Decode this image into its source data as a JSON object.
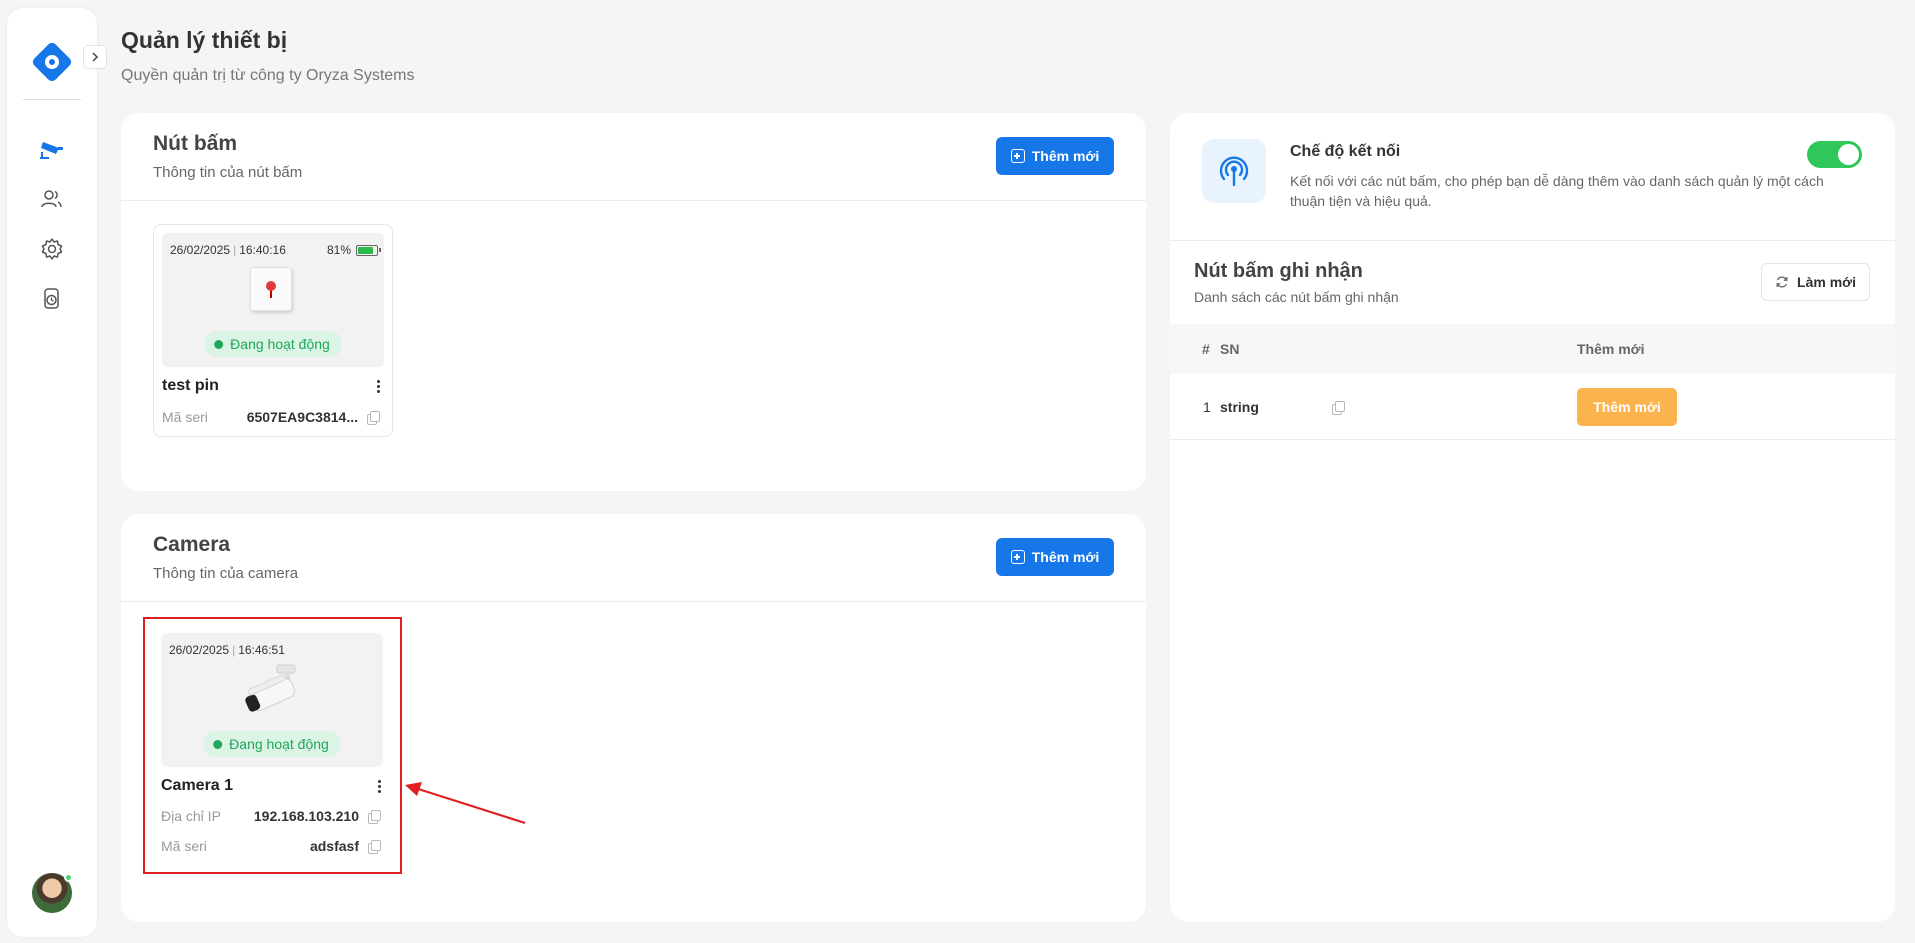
{
  "page": {
    "title": "Quản lý thiết bị",
    "subtitle": "Quyền quản trị từ công ty Oryza Systems"
  },
  "sidebar": {
    "items": [
      {
        "icon": "camera-icon"
      },
      {
        "icon": "users-icon"
      },
      {
        "icon": "settings-icon"
      },
      {
        "icon": "device-clock-icon"
      }
    ]
  },
  "buttons_card": {
    "title": "Nút bấm",
    "subtitle": "Thông tin của nút bấm",
    "add_label": "Thêm mới",
    "devices": [
      {
        "date": "26/02/2025",
        "time": "16:40:16",
        "battery": "81%",
        "status": "Đang hoạt động",
        "name": "test pin",
        "serial_label": "Mã seri",
        "serial": "6507EA9C3814..."
      }
    ]
  },
  "camera_card": {
    "title": "Camera",
    "subtitle": "Thông tin của camera",
    "add_label": "Thêm mới",
    "devices": [
      {
        "date": "26/02/2025",
        "time": "16:46:51",
        "status": "Đang hoạt động",
        "name": "Camera 1",
        "ip_label": "Địa chỉ IP",
        "ip": "192.168.103.210",
        "serial_label": "Mã seri",
        "serial": "adsfasf"
      }
    ]
  },
  "connection": {
    "title": "Chế độ kết nối",
    "description": "Kết nối với các nút bấm, cho phép bạn dễ dàng thêm vào danh sách quản lý một cách thuận tiện và hiệu quả.",
    "enabled": true
  },
  "recorded": {
    "title": "Nút bấm ghi nhận",
    "subtitle": "Danh sách các nút bấm ghi nhận",
    "refresh_label": "Làm mới",
    "columns": [
      "#",
      "SN",
      "Thêm mới"
    ],
    "rows": [
      {
        "index": "1",
        "sn": "string",
        "action": "Thêm mới"
      }
    ]
  },
  "colors": {
    "primary": "#1677e8",
    "success": "#2fc75a",
    "warning": "#fbb34d",
    "highlight": "#e02020"
  }
}
